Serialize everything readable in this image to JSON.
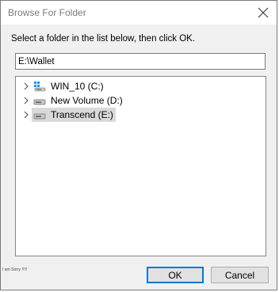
{
  "window": {
    "title": "Browse For Folder",
    "close_icon": "close-icon"
  },
  "instruction": "Select a folder in the list below, then click OK.",
  "path_field": {
    "value": "E:\\Wallet"
  },
  "tree": {
    "items": [
      {
        "label": "WIN_10 (C:)",
        "icon": "windows-drive-icon",
        "selected": false
      },
      {
        "label": "New Volume (D:)",
        "icon": "drive-icon",
        "selected": false
      },
      {
        "label": "Transcend (E:)",
        "icon": "drive-icon",
        "selected": true
      }
    ]
  },
  "status_note": "I am Sorry !!!!!",
  "buttons": {
    "ok_label": "OK",
    "cancel_label": "Cancel"
  },
  "colors": {
    "dialog_bg": "#f0f0f0",
    "selection_bg": "#d9d9d9",
    "default_button_border": "#0078d7"
  }
}
